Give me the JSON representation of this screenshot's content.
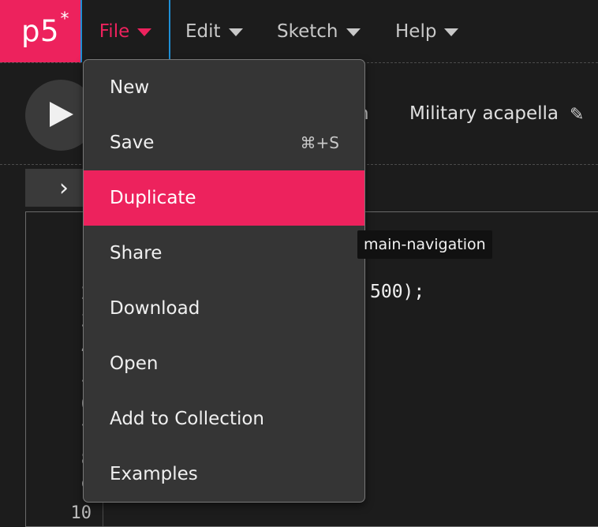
{
  "app": {
    "logo": "p5",
    "logo_mark": "*"
  },
  "nav": {
    "file": "File",
    "edit": "Edit",
    "sketch": "Sketch",
    "help": "Help"
  },
  "toolbar": {
    "sketch_name_fragment": "n",
    "sketch_name": "Military acapella"
  },
  "menu": {
    "items": [
      {
        "label": "New",
        "shortcut": ""
      },
      {
        "label": "Save",
        "shortcut": "⌘+S"
      },
      {
        "label": "Duplicate",
        "shortcut": "",
        "active": true
      },
      {
        "label": "Share",
        "shortcut": ""
      },
      {
        "label": "Download",
        "shortcut": ""
      },
      {
        "label": "Open",
        "shortcut": ""
      },
      {
        "label": "Add to Collection",
        "shortcut": ""
      },
      {
        "label": "Examples",
        "shortcut": ""
      }
    ]
  },
  "tooltip": {
    "text": "main-navigation"
  },
  "editor": {
    "line_numbers": [
      "1",
      "2",
      "3",
      "4",
      "5",
      "6",
      "7",
      "8",
      "9",
      "10"
    ],
    "visible_code_fragment": "500);"
  },
  "colors": {
    "accent": "#ed225d",
    "background": "#1c1c1c",
    "menu_bg": "#353535",
    "focus_outline": "#1f8fd6"
  },
  "icons": {
    "play": "play-icon",
    "side_toggle": "chevron-right-icon",
    "edit_name": "pencil-icon",
    "dropdown": "caret-down-icon"
  }
}
